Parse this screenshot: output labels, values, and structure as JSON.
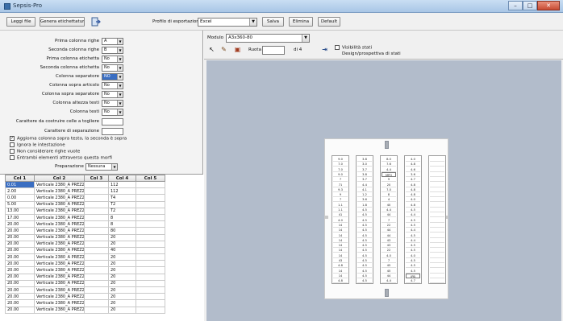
{
  "window": {
    "title": "Sepsis-Pro"
  },
  "toolbar": {
    "leggi_file": "Leggi file",
    "genera_etichette": "Genera etichettatura",
    "profile_label": "Profilo di esportazione",
    "profile_value": "Excel",
    "salva": "Salva",
    "elimina": "Elimina",
    "default": "Default"
  },
  "form": {
    "rows": [
      {
        "label": "Prima colonna righe",
        "value": "A"
      },
      {
        "label": "Seconda colonna righe",
        "value": "B"
      },
      {
        "label": "Prima colonna etichetta",
        "value": "No"
      },
      {
        "label": "Seconda colonna etichetta",
        "value": "No"
      },
      {
        "label": "Colonna separatore",
        "value": "NO"
      },
      {
        "label": "Colonna sopra articolo",
        "value": "No"
      },
      {
        "label": "Colonna sopra separatore",
        "value": "No"
      },
      {
        "label": "Colonna altezza testi",
        "value": "No"
      },
      {
        "label": "Colonna testi",
        "value": "No"
      }
    ],
    "field_label_1": "Carattere da costruire celle a togliere",
    "field_label_2": "Carattere di separazione",
    "checks": [
      {
        "label": "Aggiorna colonna sopra testo, la seconda è sopra",
        "checked": true
      },
      {
        "label": "Ignora le intestazione",
        "checked": false
      },
      {
        "label": "Non considerare righe vuote",
        "checked": false
      },
      {
        "label": "Entrambi elementi attraverso questa morfi",
        "checked": false
      }
    ],
    "preparazione_label": "Preparazione",
    "preparazione_value": "Nessuna"
  },
  "grid": {
    "headers": [
      "Col 1",
      "Col 2",
      "Col 3",
      "Col 4",
      "Col 5"
    ],
    "rows": [
      [
        "0.01",
        "Verticale 2380_A PREZZ3",
        "",
        "112",
        ""
      ],
      [
        "2.00",
        "Verticale 2380_A PREZZ3",
        "",
        "112",
        ""
      ],
      [
        "0.00",
        "Verticale 2380_A PREZZ3",
        "",
        "T4",
        ""
      ],
      [
        "5.00",
        "Verticale 2380_A PREZZ3",
        "",
        "T2",
        ""
      ],
      [
        "13.00",
        "Verticale 2380_A PREZZ3",
        "",
        "T2",
        ""
      ],
      [
        "17.00",
        "Verticale 2380_A PREZZ3",
        "",
        "8",
        ""
      ],
      [
        "20.00",
        "Verticale 2380_A PREZZ3",
        "",
        "8",
        ""
      ],
      [
        "20.00",
        "Verticale 2380_A PREZZ3",
        "",
        "80",
        ""
      ],
      [
        "20.00",
        "Verticale 2380_A PREZZ3",
        "",
        "20",
        ""
      ],
      [
        "20.00",
        "Verticale 2380_A PREZZ3",
        "",
        "20",
        ""
      ],
      [
        "20.00",
        "Verticale 2380_A PREZZ3",
        "",
        "40",
        ""
      ],
      [
        "20.00",
        "Verticale 2380_A PREZZ3",
        "",
        "20",
        ""
      ],
      [
        "20.00",
        "Verticale 2380_A PREZZ3",
        "",
        "20",
        ""
      ],
      [
        "20.00",
        "Verticale 2380_A PREZZ3",
        "",
        "20",
        ""
      ],
      [
        "20.00",
        "Verticale 2380_A PREZZ3",
        "",
        "20",
        ""
      ],
      [
        "20.00",
        "Verticale 2380_A PREZZ3",
        "",
        "20",
        ""
      ],
      [
        "20.00",
        "Verticale 2380_A PREZZ3",
        "",
        "20",
        ""
      ],
      [
        "20.00",
        "Verticale 2380_A PREZZ3",
        "",
        "20",
        ""
      ],
      [
        "20.00",
        "Verticale 2380_A PREZZ3",
        "",
        "20",
        ""
      ],
      [
        "20.00",
        "Verticale 2380_A PREZZ3",
        "",
        "20",
        ""
      ]
    ]
  },
  "right": {
    "modulo_label": "Modulo",
    "modulo_value": "A3x360-80",
    "ruota_label": "Ruota",
    "ruota_value": "",
    "unit": "di 4",
    "check_label_1": "Visibilità stati",
    "check_label_2": "Design/prospettiva di stati"
  },
  "sheet": {
    "strips": [
      [
        "9.0",
        "7.0",
        "7.0",
        "9.0",
        "7",
        "71",
        "9.3",
        "9",
        "7",
        "1.1",
        "1.1",
        "41",
        "4.0",
        "14",
        "14",
        "14",
        "14",
        "14",
        "14",
        "14",
        "43",
        "4.8",
        "14",
        "14",
        "4.8"
      ],
      [
        "3.8",
        "3.0",
        "3.7",
        "3.8",
        "3.7",
        "4.4",
        "4.1",
        "1.2",
        "3.6",
        "1.8",
        "4.5",
        "4.5",
        "4.5",
        "4.5",
        "4.5",
        "4.5",
        "4.5",
        "4.5",
        "4.5",
        "4.5",
        "4.5",
        "4.5",
        "4.5",
        "4.5",
        "4.5"
      ],
      [
        "8.0",
        "7.6",
        "4.4",
        "MPO",
        "9",
        "20",
        "7.0",
        "8",
        "4",
        "40",
        "4.4",
        "44",
        "7",
        "22",
        "44",
        "44",
        "43",
        "43",
        "22",
        "4.0",
        "7",
        "45",
        "45",
        "44",
        "4.4"
      ],
      [
        "4.0",
        "4.8",
        "4.6",
        "3.6",
        "4.7",
        "4.8",
        "4.8",
        "4.8",
        "4.0",
        "4.8",
        "4.5",
        "4.4",
        "4.5",
        "4.5",
        "4.4",
        "4.5",
        "4.4",
        "4.5",
        "4.5",
        "4.0",
        "4.5",
        "4.5",
        "4.5",
        "IPB",
        "4.7"
      ],
      [
        "",
        "",
        "",
        "",
        "",
        "",
        "",
        "",
        "",
        "",
        "",
        "",
        "",
        "",
        "",
        "",
        "",
        "",
        "",
        "",
        "",
        "",
        "",
        "",
        ""
      ]
    ]
  }
}
